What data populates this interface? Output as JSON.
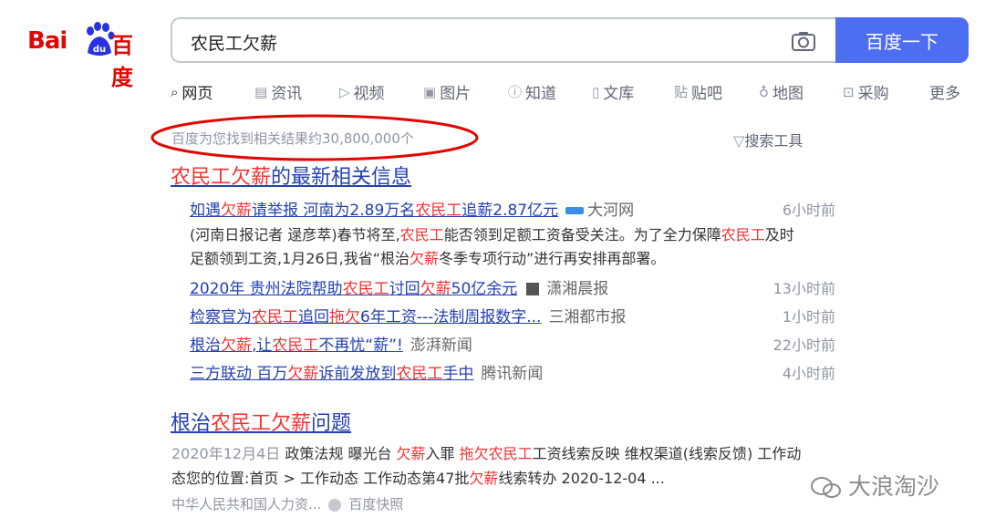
{
  "logo": {
    "bai": "Bai",
    "du": "du",
    "cn": "百度"
  },
  "search": {
    "query": "农民工欠薪",
    "button_label": "百度一下"
  },
  "tabs": [
    {
      "label": "网页",
      "icon": "search-icon"
    },
    {
      "label": "资讯",
      "icon": "news-icon"
    },
    {
      "label": "视频",
      "icon": "video-icon"
    },
    {
      "label": "图片",
      "icon": "image-icon"
    },
    {
      "label": "知道",
      "icon": "question-icon"
    },
    {
      "label": "文库",
      "icon": "document-icon"
    },
    {
      "label": "贴吧",
      "icon": "tieba-icon"
    },
    {
      "label": "地图",
      "icon": "map-icon"
    },
    {
      "label": "采购",
      "icon": "purchase-icon"
    },
    {
      "label": "更多",
      "icon": ""
    }
  ],
  "result_count": "百度为您找到相关结果约30,800,000个",
  "search_tools": "搜索工具",
  "news": {
    "title_red": "农民工欠薪",
    "title_rest": "的最新相关信息",
    "items": [
      {
        "p1": "如遇",
        "r1": "欠薪",
        "p2": "请举报 河南为2.89万名",
        "r2": "农民工",
        "p3": "追薪2.87亿元",
        "source": "大河网",
        "time": "6小时前"
      },
      {
        "p1": "2020年 贵州法院帮助",
        "r1": "农民工",
        "p2": "讨回",
        "r2": "欠薪",
        "p3": "50亿余元",
        "source": "潇湘晨报",
        "time": "13小时前"
      },
      {
        "p1": "检察官为",
        "r1": "农民工",
        "p2": "追回",
        "r2": "拖欠",
        "p3": "6年工资---法制周报数字...",
        "source": "三湘都市报",
        "time": "1小时前"
      },
      {
        "p1": "根治",
        "r1": "欠薪",
        "p2": ",让",
        "r2": "农民工",
        "p3": "不再忧“薪”!",
        "source": "澎湃新闻",
        "time": "22小时前"
      },
      {
        "p1": "三方联动 百万",
        "r1": "欠薪",
        "p2": "诉前发放到",
        "r2": "农民工",
        "p3": "手中",
        "source": "腾讯新闻",
        "time": "4小时前"
      }
    ],
    "abstract_line1": {
      "a": "(河南日报记者 逯彦萃)春节将至,",
      "r1": "农民工",
      "b": "能否领到足额工资备受关注。为了全力保障",
      "r2": "农民工",
      "c": "及时"
    },
    "abstract_line2": {
      "a": "足额领到工资,1月26日,我省“根治",
      "r1": "欠薪",
      "b": "冬季专项行动”进行再安排再部署。"
    }
  },
  "result2": {
    "title_a": "根治",
    "title_red": "农民工欠薪",
    "title_b": "问题",
    "line1": {
      "date": "2020年12月4日",
      "a": " 政策法规 曝光台 ",
      "r1": "欠薪",
      "b": "入罪 ",
      "r2": "拖欠农民工",
      "c": "工资线索反映 维权渠道(线索反馈) 工作动"
    },
    "line2": {
      "a": "态您的位置:首页 > 工作动态 工作动态第47批",
      "r1": "欠薪",
      "b": "线索转办 2020-12-04 ..."
    },
    "source": "中华人民共和国人力资...",
    "kuaizhao": "百度快照"
  },
  "watermark": "大浪淘沙",
  "colors": {
    "accent": "#4e6ef2",
    "link": "#2440b3",
    "highlight": "#f73131",
    "logo": "#e10601",
    "annotation": "#e10601"
  }
}
